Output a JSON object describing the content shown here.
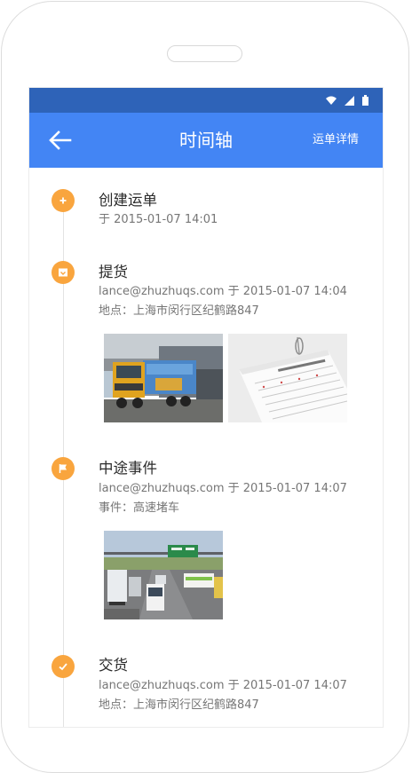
{
  "toolbar": {
    "title": "时间轴",
    "action_label": "运单详情"
  },
  "events": [
    {
      "title": "创建运单",
      "lines": [
        "于 2015-01-07 14:01"
      ],
      "icon": "plus-icon"
    },
    {
      "title": "提货",
      "lines": [
        "lance@zhuzhuqs.com 于 2015-01-07 14:04",
        "地点：上海市闵行区纪鹤路847"
      ],
      "icon": "box-icon",
      "photos": [
        "truck-photo",
        "navigator-document-photo"
      ]
    },
    {
      "title": "中途事件",
      "lines": [
        "lance@zhuzhuqs.com 于 2015-01-07 14:07",
        "事件：高速堵车"
      ],
      "icon": "flag-icon",
      "photos": [
        "highway-traffic-photo"
      ]
    },
    {
      "title": "交货",
      "lines": [
        "lance@zhuzhuqs.com 于 2015-01-07 14:07",
        "地点：上海市闵行区纪鹤路847"
      ],
      "icon": "check-icon"
    }
  ],
  "colors": {
    "statusbar": "#2e63b8",
    "toolbar": "#4385f4",
    "accent": "#f9a53e"
  }
}
